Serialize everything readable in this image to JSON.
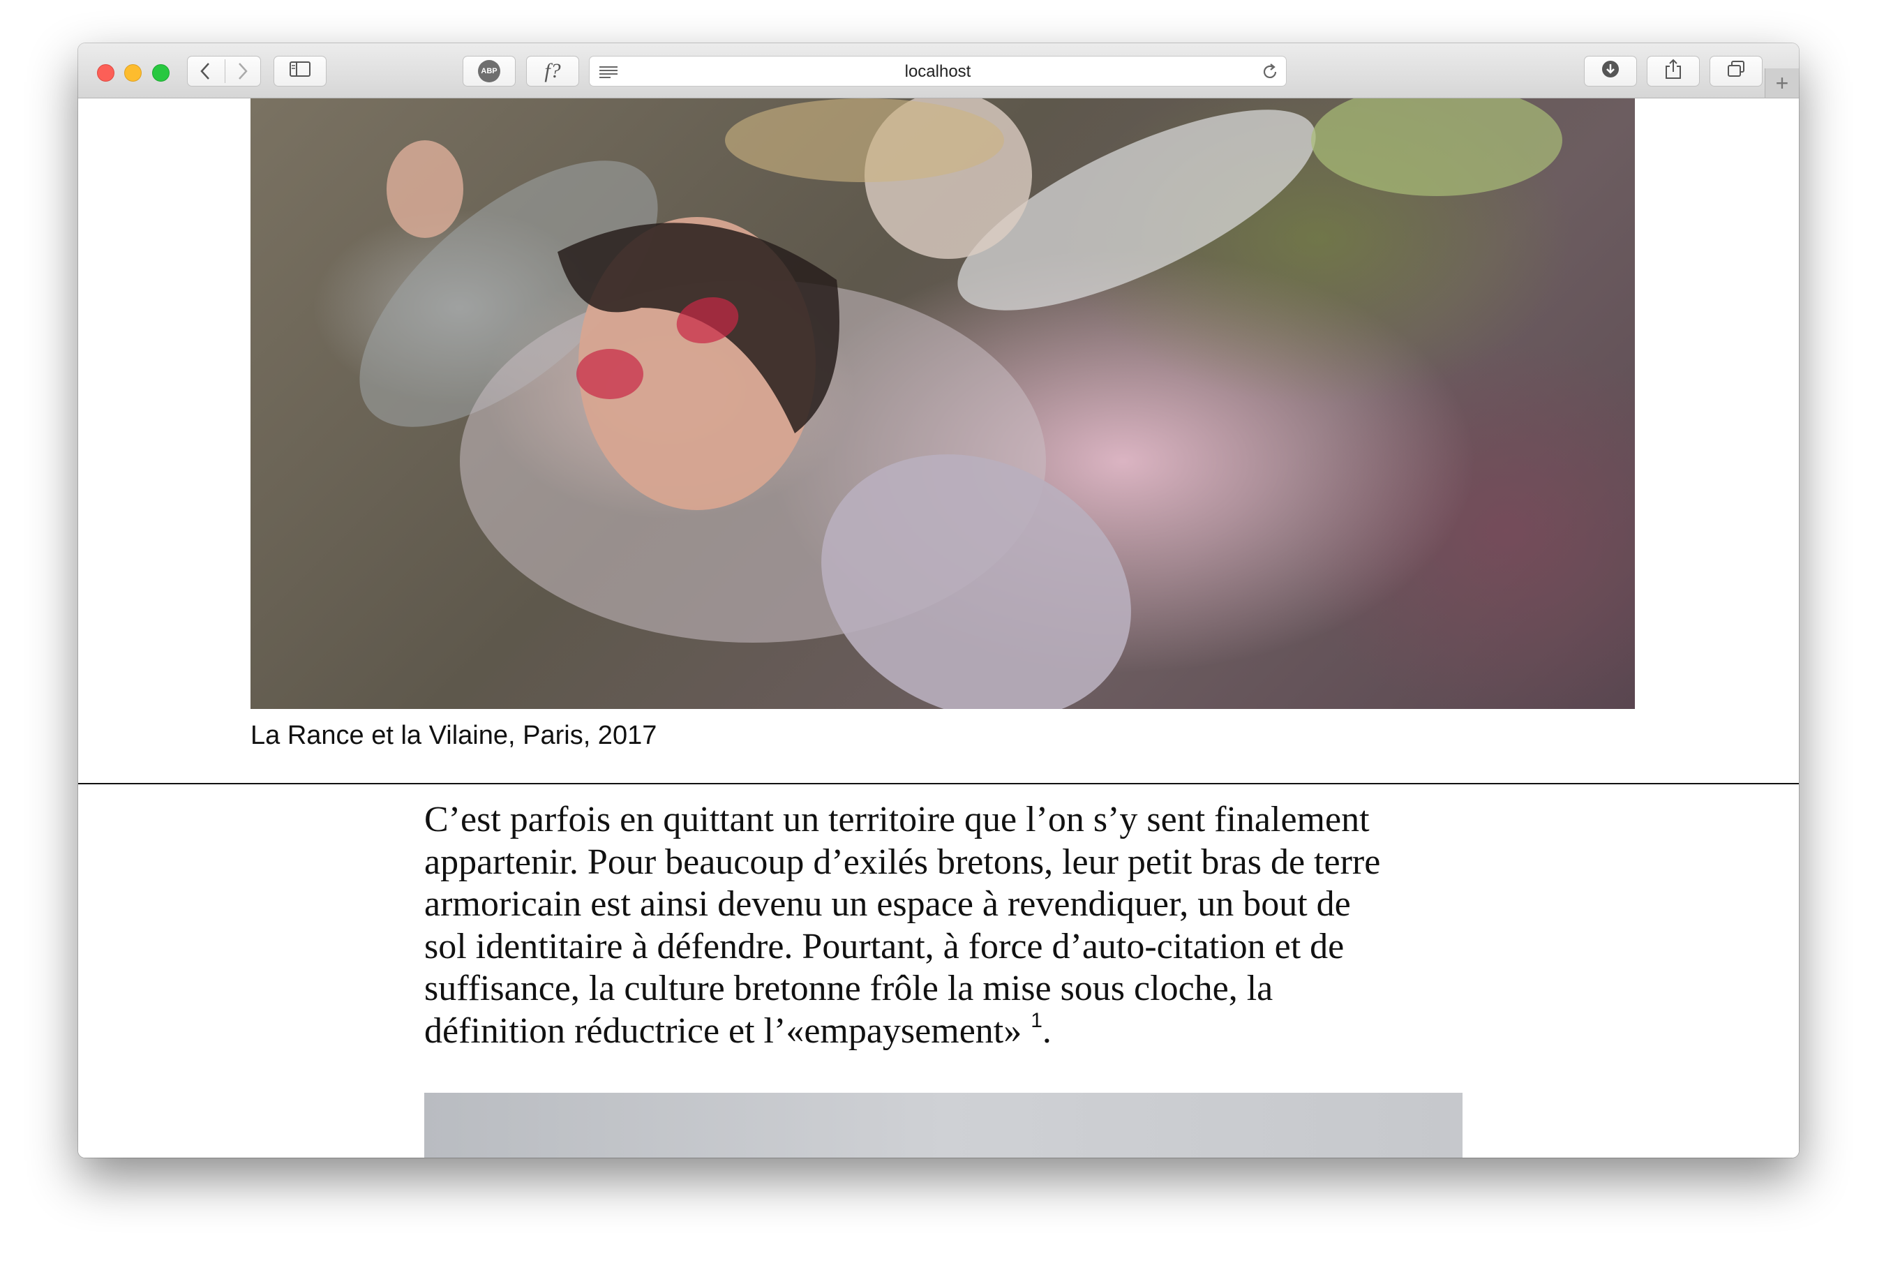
{
  "browser": {
    "url": "localhost",
    "toolbar": {
      "back_icon": "chevron-left-icon",
      "forward_icon": "chevron-right-icon",
      "sidebar_icon": "sidebar-icon",
      "adblock_label": "ABP",
      "font_ext_label": "f?",
      "reader_icon": "reader-icon",
      "reload_icon": "reload-icon",
      "download_icon": "download-icon",
      "share_icon": "share-icon",
      "tabs_icon": "tabs-icon",
      "new_tab_label": "+"
    }
  },
  "article": {
    "caption": "La Rance et la Vilaine, Paris, 2017",
    "paragraph_lines": [
      "C’est parfois en quittant un territoire que l’on s’y sent finalement",
      "appartenir. Pour beaucoup d’exilés bretons, leur petit bras de terre",
      "armoricain est ainsi devenu un espace à revendiquer, un bout de",
      "sol identitaire à défendre. Pourtant, à force d’auto-citation et de",
      "suffisance, la culture bretonne frôle la mise sous cloche, la",
      "définition réductrice et l’«empaysement» "
    ],
    "footnote_ref": "1",
    "paragraph_end": "."
  }
}
